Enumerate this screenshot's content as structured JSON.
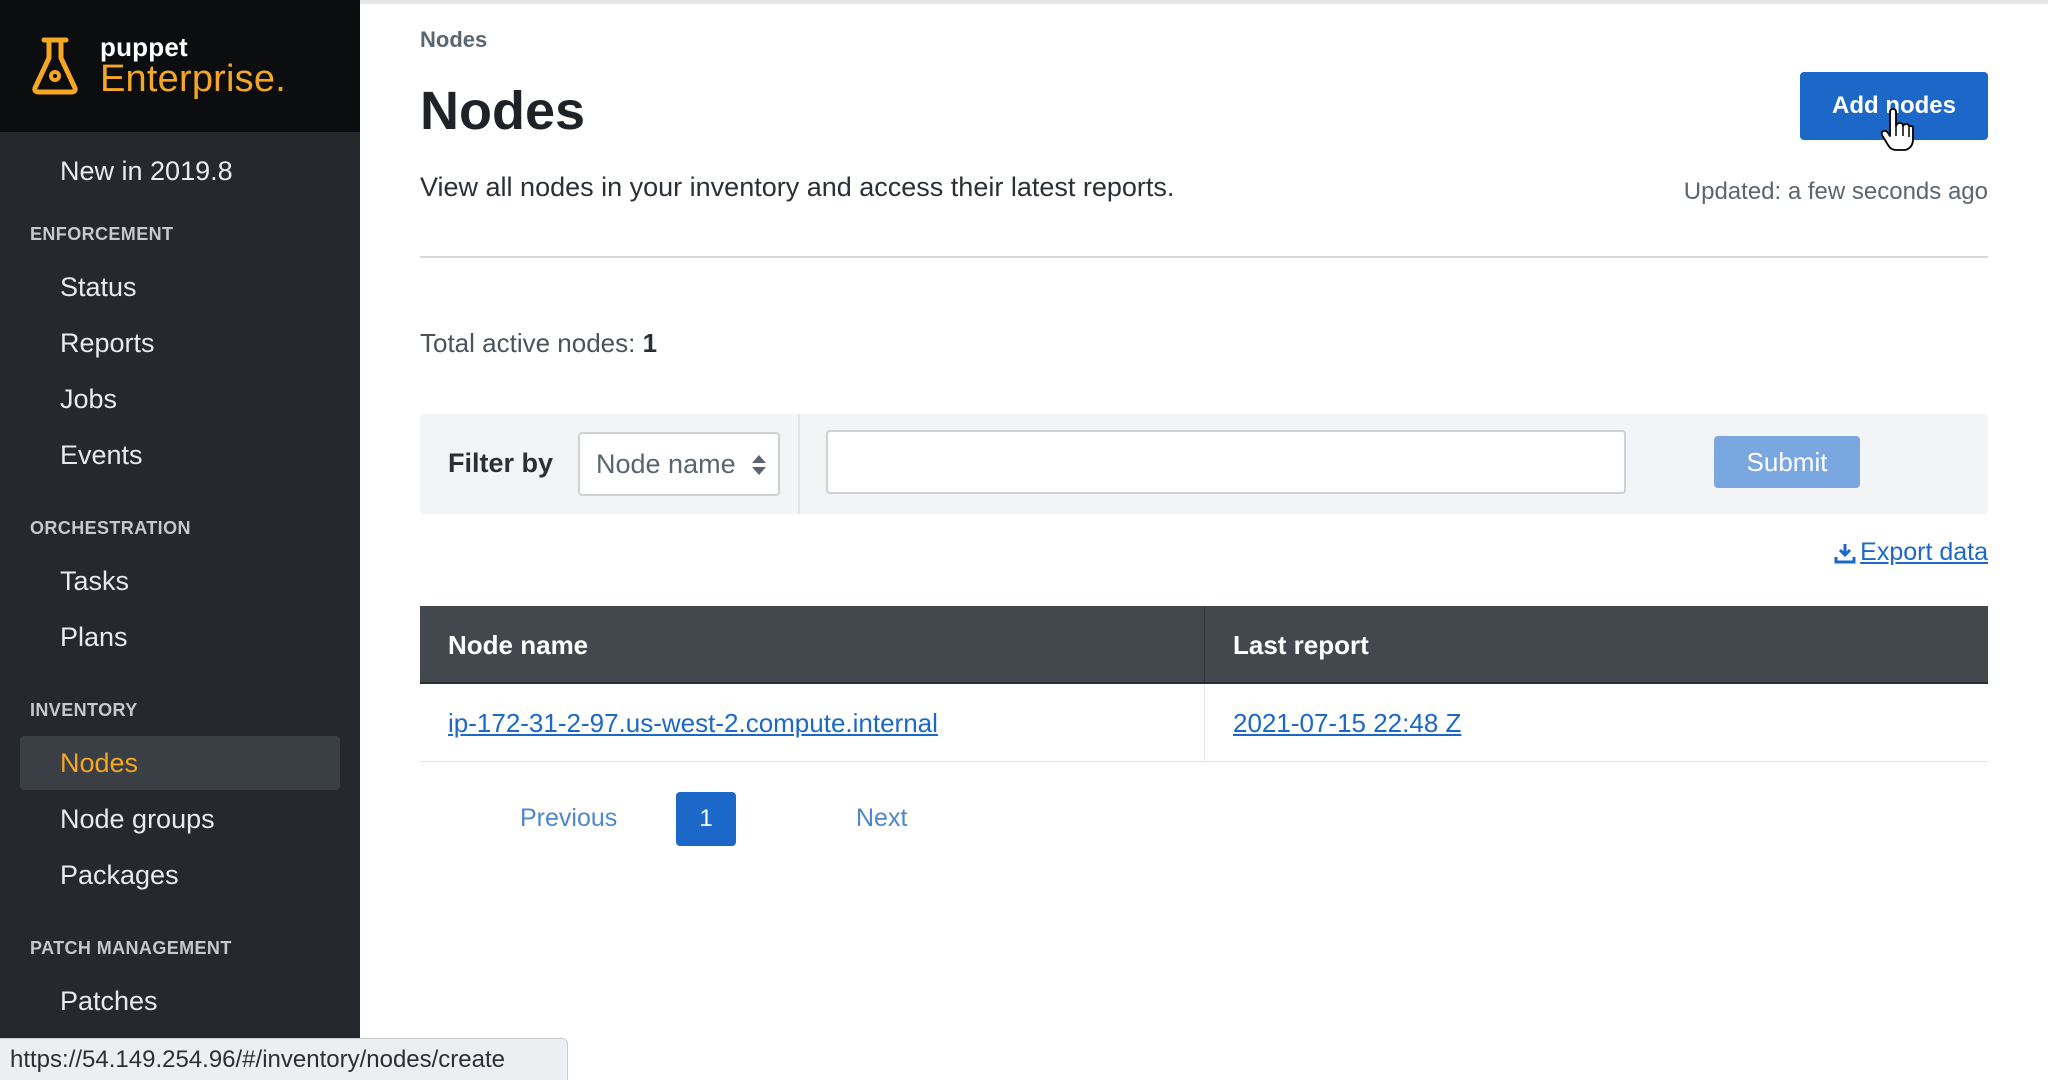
{
  "brand": {
    "small": "puppet",
    "big": "Enterprise",
    "dot": "."
  },
  "sidebar": {
    "new_item": "New in 2019.8",
    "sections": {
      "enforcement": "ENFORCEMENT",
      "orchestration": "ORCHESTRATION",
      "inventory": "INVENTORY",
      "patch": "PATCH MANAGEMENT"
    },
    "items": {
      "status": "Status",
      "reports": "Reports",
      "jobs": "Jobs",
      "events": "Events",
      "tasks": "Tasks",
      "plans": "Plans",
      "nodes": "Nodes",
      "node_groups": "Node groups",
      "packages": "Packages",
      "patches": "Patches"
    },
    "active": "Nodes"
  },
  "header": {
    "breadcrumb": "Nodes",
    "title": "Nodes",
    "description": "View all nodes in your inventory and access their latest reports.",
    "add_button": "Add nodes",
    "updated": "Updated: a few seconds ago"
  },
  "summary": {
    "label": "Total active nodes: ",
    "count": "1"
  },
  "filter": {
    "label": "Filter by",
    "select_value": "Node name",
    "input_value": "",
    "submit": "Submit"
  },
  "export_label": "Export data",
  "table": {
    "columns": [
      "Node name",
      "Last report"
    ],
    "rows": [
      {
        "node": "ip-172-31-2-97.us-west-2.compute.internal",
        "last_report": "2021-07-15 22:48 Z"
      }
    ]
  },
  "pagination": {
    "previous": "Previous",
    "current": "1",
    "next": "Next"
  },
  "status_bar_url": "https://54.149.254.96/#/inventory/nodes/create",
  "colors": {
    "accent": "#1b68c9",
    "brand_orange": "#f5a623",
    "sidebar_bg": "#25292e",
    "table_header_bg": "#43484e"
  }
}
